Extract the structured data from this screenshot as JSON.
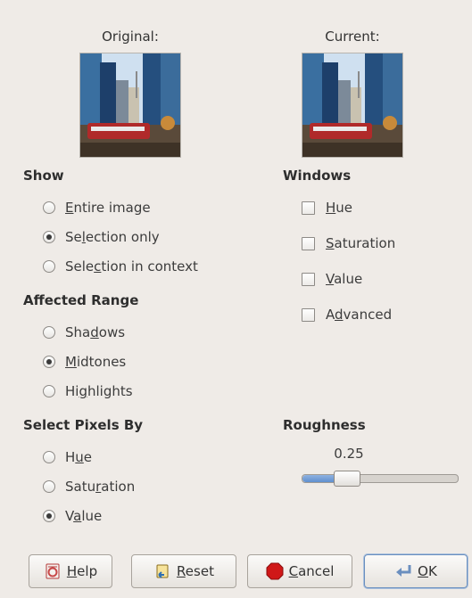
{
  "previews": {
    "original_caption": "Original:",
    "current_caption": "Current:"
  },
  "show": {
    "title": "Show",
    "options": [
      {
        "pre": "",
        "mn": "E",
        "post": "ntire image",
        "checked": false
      },
      {
        "pre": "Se",
        "mn": "l",
        "post": "ection only",
        "checked": true
      },
      {
        "pre": "Sele",
        "mn": "c",
        "post": "tion in context",
        "checked": false
      }
    ]
  },
  "affected_range": {
    "title": "Affected Range",
    "options": [
      {
        "pre": "Sha",
        "mn": "d",
        "post": "ows",
        "checked": false
      },
      {
        "pre": "",
        "mn": "M",
        "post": "idtones",
        "checked": true
      },
      {
        "pre": "Hi",
        "mn": "g",
        "post": "hlights",
        "checked": false
      }
    ]
  },
  "select_pixels_by": {
    "title": "Select Pixels By",
    "options": [
      {
        "pre": "H",
        "mn": "u",
        "post": "e",
        "checked": false
      },
      {
        "pre": "Satu",
        "mn": "r",
        "post": "ation",
        "checked": false
      },
      {
        "pre": "V",
        "mn": "a",
        "post": "lue",
        "checked": true
      }
    ]
  },
  "windows": {
    "title": "Windows",
    "options": [
      {
        "pre": "",
        "mn": "H",
        "post": "ue",
        "checked": false
      },
      {
        "pre": "",
        "mn": "S",
        "post": "aturation",
        "checked": false
      },
      {
        "pre": "",
        "mn": "V",
        "post": "alue",
        "checked": false
      },
      {
        "pre": "A",
        "mn": "d",
        "post": "vanced",
        "checked": false
      }
    ]
  },
  "roughness": {
    "title": "Roughness",
    "value_text": "0.25",
    "value_fraction": 0.25
  },
  "buttons": {
    "help": {
      "pre": "",
      "mn": "H",
      "post": "elp"
    },
    "reset": {
      "pre": "",
      "mn": "R",
      "post": "eset"
    },
    "cancel": {
      "pre": "",
      "mn": "C",
      "post": "ancel"
    },
    "ok": {
      "pre": "",
      "mn": "O",
      "post": "K"
    }
  },
  "colors": {
    "background": "#efebe7",
    "slider_fill": "#6b99d3",
    "cancel_icon": "#d01818"
  }
}
